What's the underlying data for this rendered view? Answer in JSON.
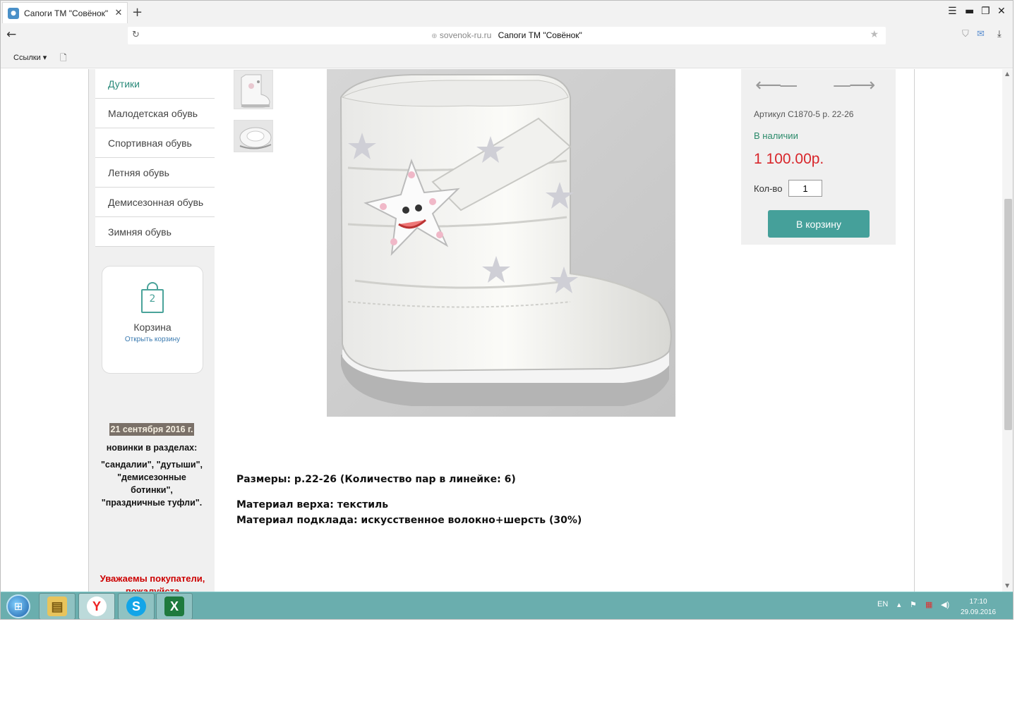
{
  "browser": {
    "tab_title": "Сапоги ТМ \"Совёнок\"",
    "url_host": "sovenok-ru.ru",
    "url_title": "Сапоги ТМ \"Совёнок\"",
    "bookmarks_label": "Ссылки"
  },
  "sidebar": {
    "menu": [
      {
        "label": "Дутики"
      },
      {
        "label": "Малодетская обувь"
      },
      {
        "label": "Спортивная обувь"
      },
      {
        "label": "Летняя обувь"
      },
      {
        "label": "Демисезонная обувь"
      },
      {
        "label": "Зимняя обувь"
      }
    ],
    "cart": {
      "count": "2",
      "title": "Корзина",
      "link": "Открыть корзину"
    },
    "news": {
      "date": "21 сентября 2016 г.",
      "subtitle": "новинки в разделах:",
      "line1": "\"сандалии\", \"дутыши\",",
      "line2": "\"демисезонные",
      "line3": "ботинки\",",
      "line4": "\"праздничные туфли\"."
    },
    "notice_line1": "Уважаемы покупатели,",
    "notice_line2": "пожалуйста"
  },
  "product": {
    "sku": "Артикул С1870-5 р. 22-26",
    "availability": "В наличии",
    "price": "1 100.00р.",
    "qty_label": "Кол-во",
    "qty_value": "1",
    "add_to_cart": "В корзину",
    "sizes": "Размеры: р.22-26 (Количество пар в линейке: 6)",
    "material_top": "Материал верха: текстиль",
    "material_lining": "Материал подклада: искусственное волокно+шерсть (30%)"
  },
  "taskbar": {
    "lang": "EN",
    "time": "17:10",
    "date": "29.09.2016"
  },
  "colors": {
    "accent": "#45a09a",
    "price": "#d8262b",
    "notice": "#cc0000",
    "taskbar": "#6aaeae"
  }
}
